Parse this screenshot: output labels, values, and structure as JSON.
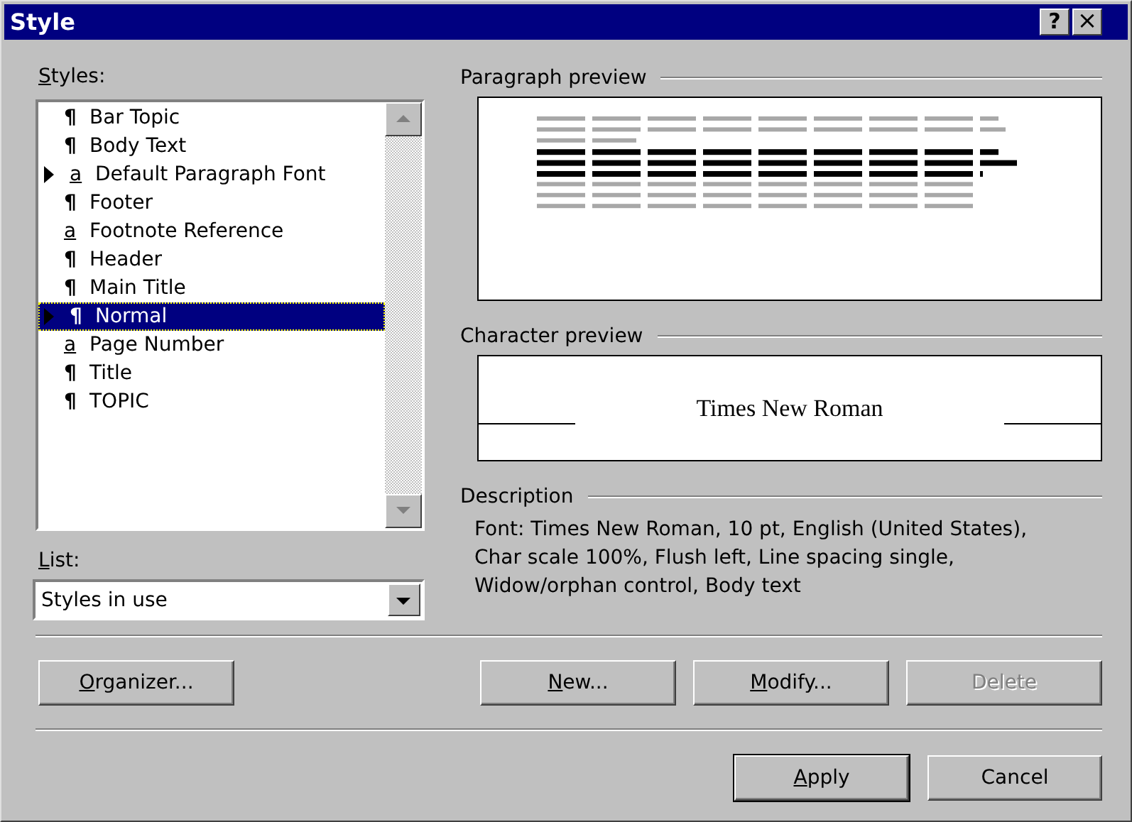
{
  "window": {
    "title": "Style",
    "buttons": [
      {
        "kind": "help",
        "glyph": "?"
      },
      {
        "kind": "close",
        "glyph": "×"
      }
    ]
  },
  "styles": {
    "label": {
      "key": "S",
      "after": "tyles:"
    },
    "items": [
      {
        "icon": "¶",
        "kind": "paragraph",
        "name": "Bar Topic",
        "marked": false,
        "selected": false
      },
      {
        "icon": "¶",
        "kind": "paragraph",
        "name": "Body Text",
        "marked": false,
        "selected": false
      },
      {
        "icon": "a",
        "kind": "character",
        "name": "Default Paragraph Font",
        "marked": true,
        "selected": false
      },
      {
        "icon": "¶",
        "kind": "paragraph",
        "name": "Footer",
        "marked": false,
        "selected": false
      },
      {
        "icon": "a",
        "kind": "character",
        "name": "Footnote Reference",
        "marked": false,
        "selected": false
      },
      {
        "icon": "¶",
        "kind": "paragraph",
        "name": "Header",
        "marked": false,
        "selected": false
      },
      {
        "icon": "¶",
        "kind": "paragraph",
        "name": "Main Title",
        "marked": false,
        "selected": false
      },
      {
        "icon": "¶",
        "kind": "paragraph",
        "name": "Normal",
        "marked": true,
        "selected": true
      },
      {
        "icon": "a",
        "kind": "character",
        "name": "Page Number",
        "marked": false,
        "selected": false
      },
      {
        "icon": "¶",
        "kind": "paragraph",
        "name": "Title",
        "marked": false,
        "selected": false
      },
      {
        "icon": "¶",
        "kind": "paragraph",
        "name": "TOPIC",
        "marked": false,
        "selected": false
      }
    ]
  },
  "list": {
    "label": {
      "key": "L",
      "after": "ist:"
    },
    "value": "Styles in use"
  },
  "paragraph_preview": {
    "label": "Paragraph preview"
  },
  "character_preview": {
    "label": "Character preview",
    "font": "Times New Roman"
  },
  "description": {
    "label": "Description",
    "text": "Font: Times New Roman, 10 pt, English (United States), Char scale 100%, Flush left, Line spacing single, Widow/orphan control, Body text"
  },
  "buttons_row1": [
    {
      "label": {
        "key": "O",
        "after": "rganizer..."
      },
      "disabled": false,
      "kind": "left"
    },
    {
      "label": {
        "key": "N",
        "after": "ew..."
      },
      "disabled": false,
      "kind": "right"
    },
    {
      "label": {
        "key": "M",
        "after": "odify..."
      },
      "disabled": false,
      "kind": "right"
    },
    {
      "label": {
        "after": "Delete"
      },
      "disabled": true,
      "kind": "right"
    }
  ],
  "buttons_row2": [
    {
      "label": {
        "key": "A",
        "after": "pply"
      },
      "disabled": false,
      "default": true
    },
    {
      "label": {
        "after": "Cancel"
      },
      "disabled": false,
      "default": false
    }
  ]
}
